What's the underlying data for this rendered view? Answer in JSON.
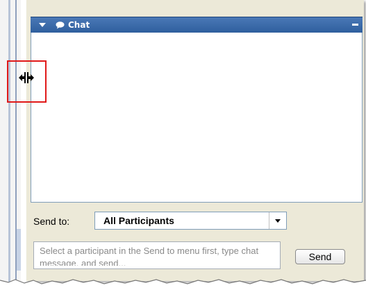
{
  "panel": {
    "title": "Chat"
  },
  "send_to": {
    "label": "Send to:",
    "selected": "All Participants"
  },
  "message": {
    "placeholder": "Select a participant in the Send to menu first, type chat message, and send..."
  },
  "send_button": {
    "label": "Send"
  },
  "colors": {
    "title_bar": "#2f5f9e",
    "highlight": "#e01919",
    "panel_background": "#ece9d8"
  }
}
